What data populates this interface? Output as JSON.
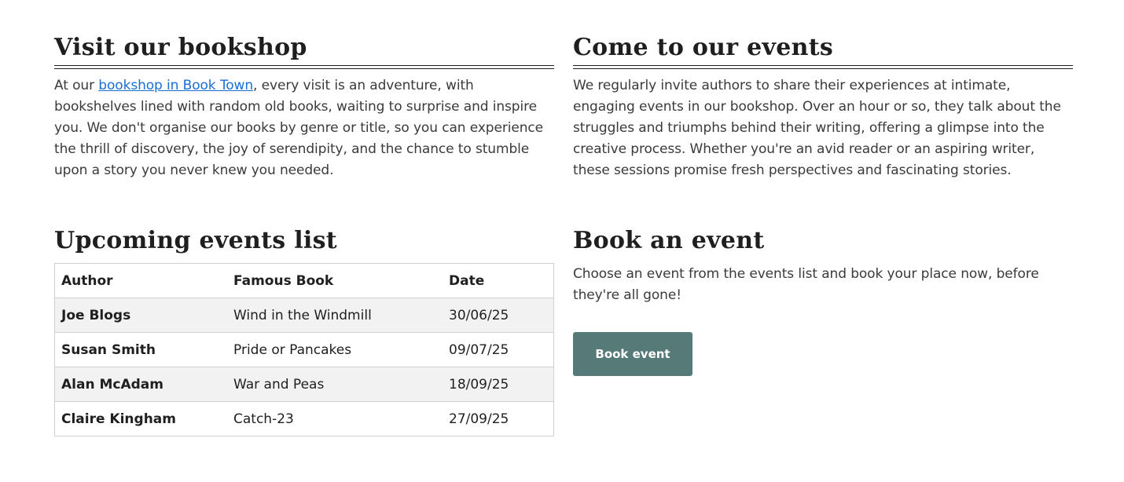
{
  "visit": {
    "heading": "Visit our bookshop",
    "text_before": "At our ",
    "link_text": "bookshop in Book Town",
    "text_after": ", every visit is an adventure, with bookshelves lined with random old books, waiting to surprise and inspire you. We don't organise our books by genre or title, so you can experience the thrill of discovery, the joy of serendipity, and the chance to stumble upon a story you never knew you needed."
  },
  "events": {
    "heading": "Come to our events",
    "text": "We regularly invite authors to share their experiences at intimate, engaging events in our bookshop. Over an hour or so, they talk about the struggles and triumphs behind their writing, offering a glimpse into the creative process. Whether you're an avid reader or an aspiring writer, these sessions promise fresh perspectives and fascinating stories."
  },
  "upcoming": {
    "heading": "Upcoming events list",
    "columns": [
      "Author",
      "Famous Book",
      "Date"
    ],
    "rows": [
      {
        "author": "Joe Blogs",
        "book": "Wind in the Windmill",
        "date": "30/06/25"
      },
      {
        "author": "Susan Smith",
        "book": "Pride or Pancakes",
        "date": "09/07/25"
      },
      {
        "author": "Alan McAdam",
        "book": "War and Peas",
        "date": "18/09/25"
      },
      {
        "author": "Claire Kingham",
        "book": "Catch-23",
        "date": "27/09/25"
      }
    ]
  },
  "book": {
    "heading": "Book an event",
    "text": "Choose an event from the events list and book your place now, before they're all gone!",
    "button_label": "Book event"
  },
  "colors": {
    "link": "#1a6fd6",
    "button": "#567a78",
    "row_shade": "#f2f2f2"
  }
}
